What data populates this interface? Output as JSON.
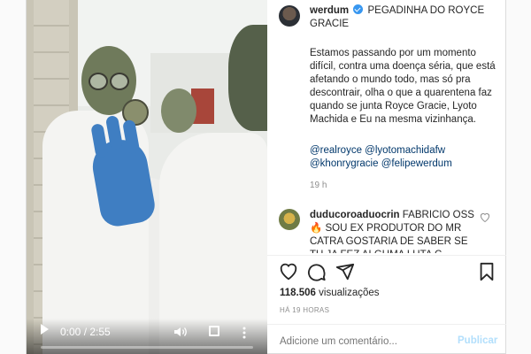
{
  "video": {
    "time": "0:00 / 2:55",
    "progress": 0.0
  },
  "post": {
    "username": "werdum",
    "title": "PEGADINHA DO ROYCE GRACIE",
    "caption": "Estamos passando por um momento difícil, contra uma doença séria, que está afetando o mundo todo, mas só pra descontrair, olha o que a quarentena faz quando se junta Royce Gracie, Lyoto Machida e Eu na mesma vizinhança.",
    "tags_line1": "@realroyce @lyotomachidafw",
    "tags_line2": "@khonrygracie @felipewerdum",
    "ago": "19 h"
  },
  "comment": {
    "username": "duducoroaduocrin",
    "text": "FABRICIO OSS 🔥 SOU EX PRODUTOR DO MR CATRA GOSTARIA DE SABER SE TU JA FEZ ALGUMA LUTA C"
  },
  "stats": {
    "views": "118.506",
    "views_label": "visualizações",
    "posted": "HÁ 19 HORAS"
  },
  "composer": {
    "placeholder": "Adicione um comentário...",
    "publish_label": "Publicar"
  },
  "icons": {
    "like": "heart-icon",
    "comment": "comment-icon",
    "share": "send-icon",
    "save": "bookmark-icon"
  },
  "colors": {
    "verified": "#3897f0",
    "link": "#00376b",
    "publish_disabled": "#b2dffc"
  }
}
